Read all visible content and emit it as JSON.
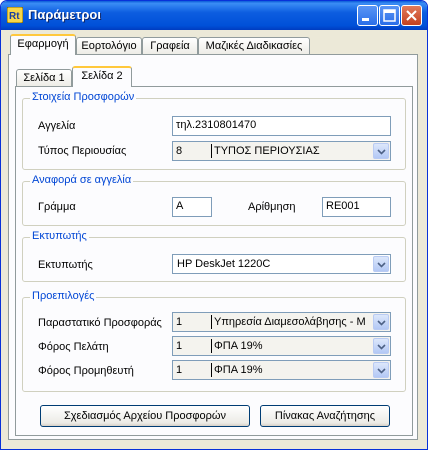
{
  "window": {
    "title": "Παράμετροι",
    "minimize_icon": "minimize-icon",
    "maximize_icon": "maximize-icon",
    "close_icon": "close-icon",
    "app_icon": "app-icon"
  },
  "tabs": [
    "Εφαρμογή",
    "Εορτολόγιο",
    "Γραφεία",
    "Μαζικές Διαδικασίες"
  ],
  "subtabs": [
    "Σελίδα 1",
    "Σελίδα 2"
  ],
  "groups": {
    "offers": {
      "title": "Στοιχεία Προσφορών",
      "ad_label": "Αγγελία",
      "ad_value": "τηλ.2310801470",
      "property_type_label": "Τύπος Περιουσίας",
      "property_type_num": "8",
      "property_type_desc": "ΤΥΠΟΣ ΠΕΡΙΟΥΣΙΑΣ"
    },
    "ad_ref": {
      "title": "Αναφορά σε αγγελία",
      "letter_label": "Γράμμα",
      "letter_value": "A",
      "numbering_label": "Αρίθμηση",
      "numbering_value": "RE001"
    },
    "printer": {
      "title": "Εκτυπωτής",
      "printer_label": "Εκτυπωτής",
      "printer_value": "HP DeskJet 1220C"
    },
    "defaults": {
      "title": "Προεπιλογές",
      "doc_label": "Παραστατικό Προσφοράς",
      "doc_num": "1",
      "doc_desc": "Υπηρεσία Διαμεσολάβησης - Μ",
      "client_tax_label": "Φόρος Πελάτη",
      "client_tax_num": "1",
      "client_tax_desc": "ΦΠΑ 19%",
      "supplier_tax_label": "Φόρος Προμηθευτή",
      "supplier_tax_num": "1",
      "supplier_tax_desc": "ΦΠΑ 19%"
    }
  },
  "buttons": {
    "design_offers": "Σχεδιασμός Αρχείου Προσφορών",
    "search_table": "Πίνακας Αναζήτησης"
  }
}
